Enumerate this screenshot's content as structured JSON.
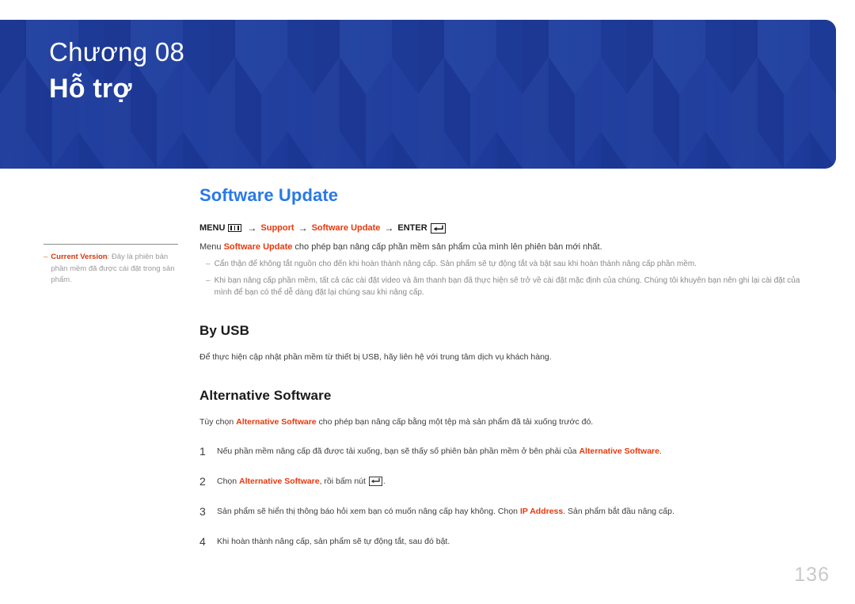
{
  "banner": {
    "chapter_label": "Chương 08",
    "chapter_title": "Hỗ trợ",
    "bg_color": "#1f3f9e"
  },
  "side_note": {
    "dash": "–",
    "term": "Current Version",
    "text": ": Đây là phiên bản phần mềm đã được cài đặt trong sản phẩm."
  },
  "main": {
    "section_title": "Software Update",
    "menu_path": {
      "menu_label": "MENU",
      "menu_icon": "menu-bars-icon",
      "arrow": "→",
      "step1": "Support",
      "step2": "Software Update",
      "enter_label": "ENTER",
      "enter_icon": "enter-key-icon"
    },
    "intro": {
      "prefix": "Menu ",
      "highlight": "Software Update",
      "suffix": " cho phép bạn nâng cấp phần mềm sản phẩm của mình lên phiên bản mới nhất."
    },
    "notes": [
      {
        "dash": "‒",
        "text": "Cẩn thận để không tắt nguồn cho đến khi hoàn thành nâng cấp. Sản phẩm sẽ tự động tắt và bật sau khi hoàn thành nâng cấp phần mềm."
      },
      {
        "dash": "‒",
        "text": "Khi bạn nâng cấp phần mềm, tất cả các cài đặt video và âm thanh bạn đã thực hiện sẽ trở về cài đặt mặc định của chúng. Chúng tôi khuyên bạn nên ghi lại cài đặt của mình để bạn có thể dễ dàng đặt lại chúng sau khi nâng cấp."
      }
    ],
    "by_usb": {
      "heading": "By USB",
      "text": "Để thực hiện cập nhật phần mềm từ thiết bị USB, hãy liên hệ với trung tâm dịch vụ khách hàng."
    },
    "alternative_software": {
      "heading": "Alternative Software",
      "intro_prefix": "Tùy chọn ",
      "intro_highlight": "Alternative Software",
      "intro_suffix": " cho phép bạn nâng cấp bằng một tệp mà sản phẩm đã tải xuống trước đó.",
      "steps": [
        {
          "num": "1",
          "prefix": "Nếu phần mềm nâng cấp đã được tải xuống, bạn sẽ thấy số phiên bản phần mềm ở bên phải của ",
          "highlight": "Alternative Software",
          "suffix": "."
        },
        {
          "num": "2",
          "prefix": "Chọn ",
          "highlight": "Alternative Software",
          "suffix": ", rồi bấm nút ",
          "has_enter_icon": true,
          "tail": "."
        },
        {
          "num": "3",
          "prefix": "Sản phẩm sẽ hiển thị thông báo hỏi xem bạn có muốn nâng cấp hay không. Chọn ",
          "highlight": "IP Address",
          "suffix": ". Sản phẩm bắt đầu nâng cấp."
        },
        {
          "num": "4",
          "prefix": "Khi hoàn thành nâng cấp, sản phẩm sẽ tự động tắt, sau đó bật.",
          "highlight": "",
          "suffix": ""
        }
      ]
    }
  },
  "footer": {
    "page_number": "136"
  },
  "colors": {
    "accent_blue": "#2979e8",
    "accent_red": "#e8380d",
    "banner_blue": "#1f3f9e"
  }
}
